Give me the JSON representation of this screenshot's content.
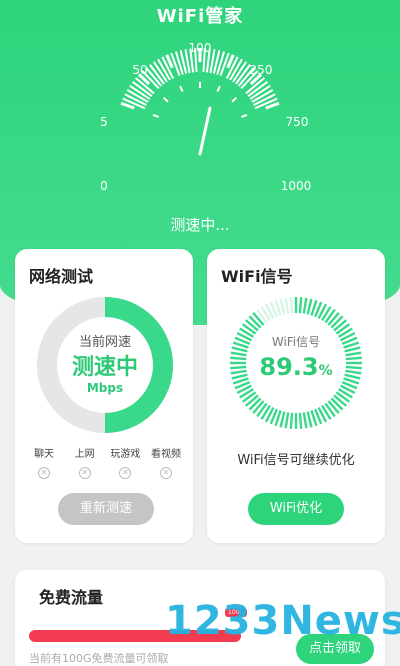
{
  "app": {
    "title": "WiFi管家"
  },
  "speedometer": {
    "labels": [
      "0",
      "5",
      "50",
      "100",
      "250",
      "750",
      "1000"
    ],
    "status": "测速中..."
  },
  "network_test": {
    "title": "网络测试",
    "current_speed_label": "当前网速",
    "speed_value": "测速中",
    "unit": "Mbps",
    "usages": [
      "聊天",
      "上网",
      "玩游戏",
      "看视频"
    ],
    "retest_button": "重新测速"
  },
  "wifi_signal": {
    "title": "WiFi信号",
    "label": "WiFi信号",
    "value": "89.3",
    "unit": "%",
    "note": "WiFi信号可继续优化",
    "optimize_button": "WiFi优化"
  },
  "free_data": {
    "title": "免费流量",
    "tag": "100G",
    "note": "当前有100G免费流量可领取",
    "claim_button": "点击领取"
  },
  "watermark": "1233News",
  "colors": {
    "accent": "#2ed47c",
    "danger": "#f23a50",
    "watermark": "#25b3df"
  }
}
